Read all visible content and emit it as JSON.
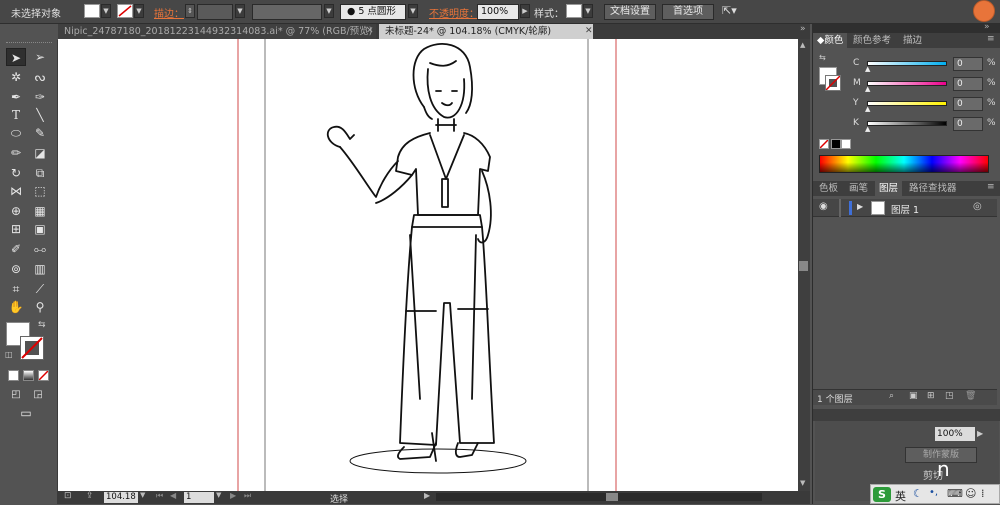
{
  "control_bar": {
    "selection_status": "未选择对象",
    "stroke_label": "描边：",
    "point_style": "5 点圆形",
    "opacity_label": "不透明度：",
    "opacity_value": "100%",
    "style_label": "样式：",
    "doc_setup_button": "文档设置",
    "preferences_button": "首选项"
  },
  "tabs": [
    {
      "label": "Nipic_24787180_20181223144932314083.ai* @ 77% (RGB/预览)"
    },
    {
      "label": "未标题-24* @ 104.18% (CMYK/轮廓)"
    }
  ],
  "color_panel": {
    "tabs": [
      "颜色",
      "颜色参考",
      "描边"
    ],
    "channels": [
      {
        "name": "C",
        "value": "0",
        "unit": "%",
        "gradient": "linear-gradient(to right,#fff,#00aeef)"
      },
      {
        "name": "M",
        "value": "0",
        "unit": "%",
        "gradient": "linear-gradient(to right,#fff,#ec008c)"
      },
      {
        "name": "Y",
        "value": "0",
        "unit": "%",
        "gradient": "linear-gradient(to right,#fff,#fff200)"
      },
      {
        "name": "K",
        "value": "0",
        "unit": "%",
        "gradient": "linear-gradient(to right,#fff,#000)"
      }
    ]
  },
  "layers_panel": {
    "tabs": [
      "色板",
      "画笔",
      "图层",
      "路径查找器"
    ],
    "layer_name": "图层 1",
    "footer_count": "1 个图层",
    "opacity_value": "100%",
    "make_mask_label": "制作蒙版",
    "clip_label": "剪切"
  },
  "status_bar": {
    "zoom_value": "104.18",
    "page_value": "1",
    "tool_status": "选择"
  },
  "taskbar": {
    "ime_logo": "S",
    "ime_lang": "英"
  },
  "overlay_fragment": "n",
  "colors": {
    "accent": "#e8743a",
    "guide": "#d04a4a"
  }
}
